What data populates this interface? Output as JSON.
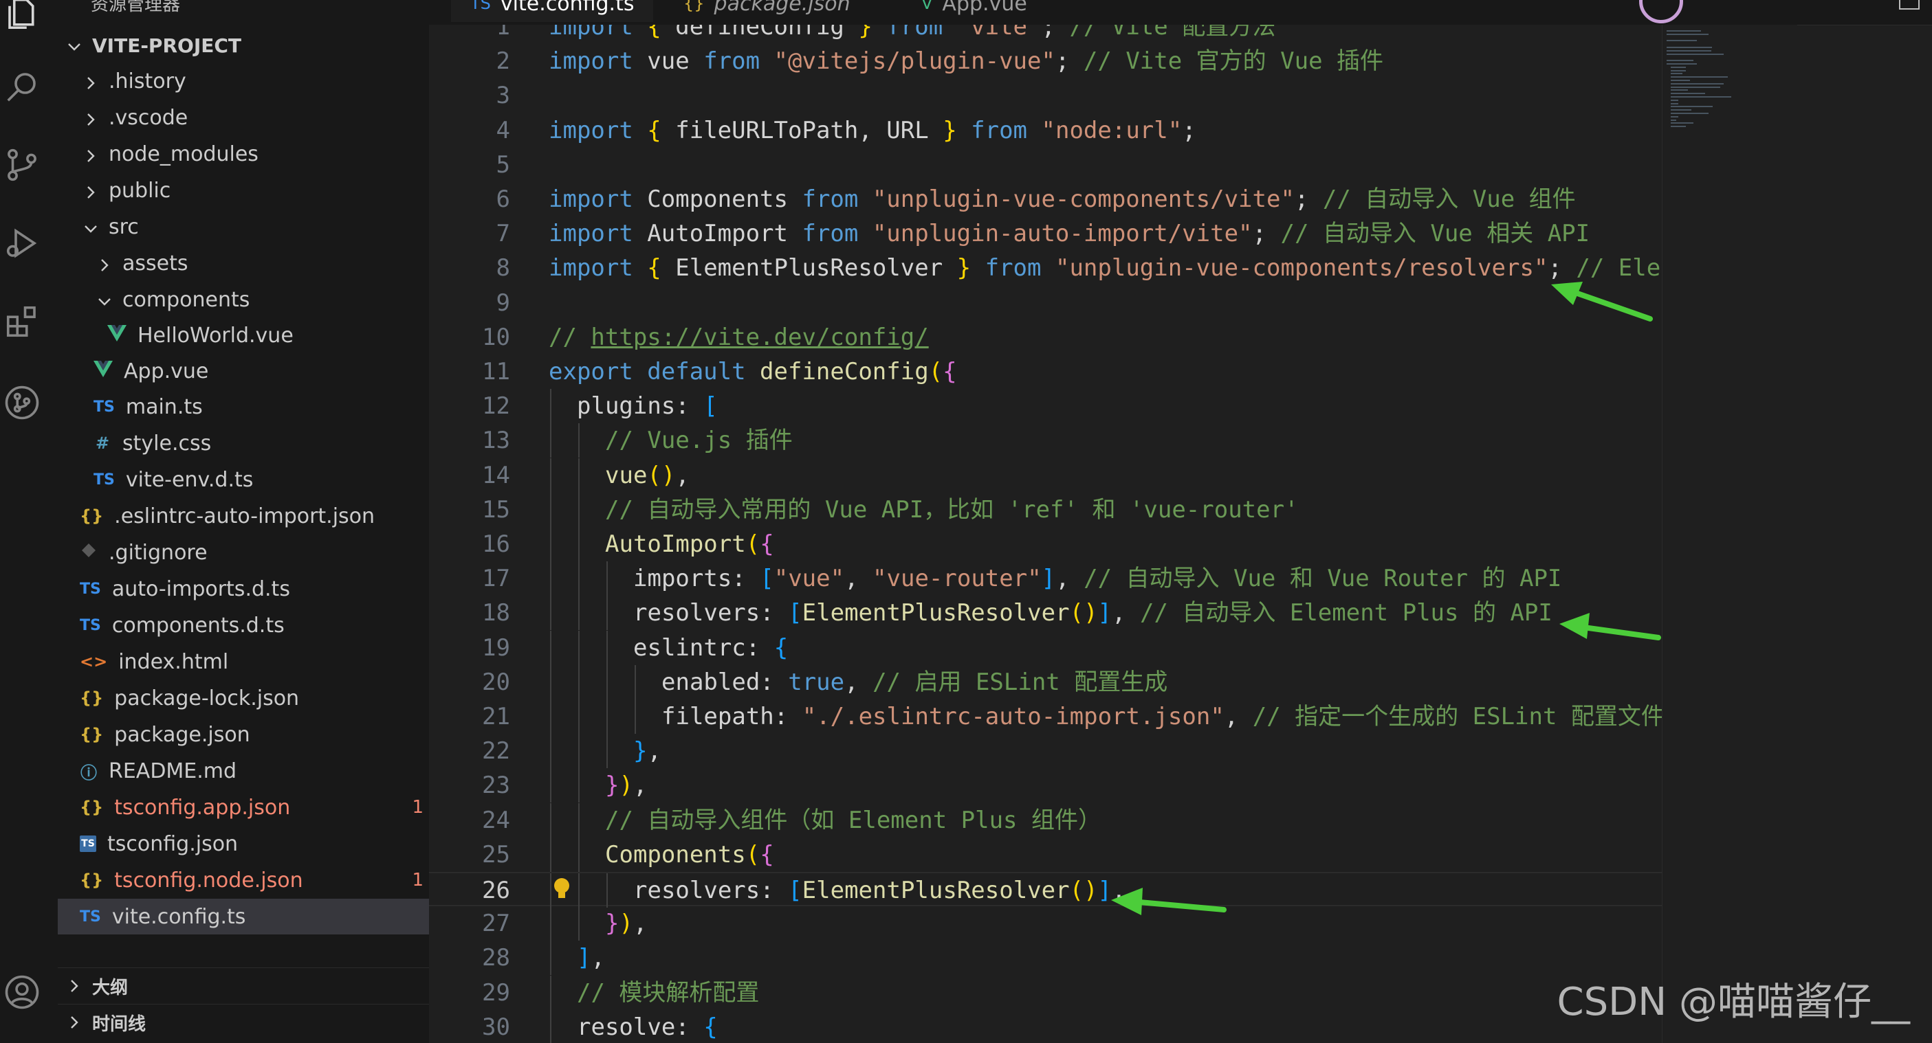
{
  "sidebar_title": "资源管理器",
  "project": {
    "name": "VITE-PROJECT"
  },
  "tree": [
    {
      "label": ".history",
      "kind": "folder",
      "expanded": false
    },
    {
      "label": ".vscode",
      "kind": "folder",
      "expanded": false
    },
    {
      "label": "node_modules",
      "kind": "folder",
      "expanded": false
    },
    {
      "label": "public",
      "kind": "folder",
      "expanded": false
    },
    {
      "label": "src",
      "kind": "folder",
      "expanded": true
    },
    {
      "label": "assets",
      "kind": "folder",
      "expanded": false
    },
    {
      "label": "components",
      "kind": "folder",
      "expanded": true
    },
    {
      "label": "HelloWorld.vue",
      "kind": "vue"
    },
    {
      "label": "App.vue",
      "kind": "vue"
    },
    {
      "label": "main.ts",
      "kind": "ts",
      "icon_text": "TS"
    },
    {
      "label": "style.css",
      "kind": "css",
      "icon_text": "#"
    },
    {
      "label": "vite-env.d.ts",
      "kind": "ts",
      "icon_text": "TS"
    },
    {
      "label": ".eslintrc-auto-import.json",
      "kind": "json",
      "icon_text": "{}"
    },
    {
      "label": ".gitignore",
      "kind": "git"
    },
    {
      "label": "auto-imports.d.ts",
      "kind": "ts",
      "icon_text": "TS"
    },
    {
      "label": "components.d.ts",
      "kind": "ts",
      "icon_text": "TS"
    },
    {
      "label": "index.html",
      "kind": "html",
      "icon_text": "<>"
    },
    {
      "label": "package-lock.json",
      "kind": "json",
      "icon_text": "{}"
    },
    {
      "label": "package.json",
      "kind": "json",
      "icon_text": "{}"
    },
    {
      "label": "README.md",
      "kind": "info",
      "icon_text": "ⓘ"
    },
    {
      "label": "tsconfig.app.json",
      "kind": "json",
      "icon_text": "{}",
      "badge": "1"
    },
    {
      "label": "tsconfig.json",
      "kind": "tsconfig",
      "icon_text": "TS"
    },
    {
      "label": "tsconfig.node.json",
      "kind": "json",
      "icon_text": "{}",
      "badge": "1"
    },
    {
      "label": "vite.config.ts",
      "kind": "ts",
      "icon_text": "TS"
    }
  ],
  "sections": {
    "outline": "大纲",
    "timeline": "时间线"
  },
  "tabs": [
    {
      "label": "vite.config.ts",
      "icon_text": "TS",
      "active": true
    },
    {
      "label": "package.json",
      "icon_text": "{}"
    },
    {
      "label": "App.vue",
      "icon_text": "V"
    }
  ],
  "code_lines": [
    {
      "n": "1",
      "indent": 0,
      "tokens": [
        [
          "k",
          "import "
        ],
        [
          "b1",
          "{ "
        ],
        [
          "id",
          "defineConfig "
        ],
        [
          "b1",
          "} "
        ],
        [
          "k",
          "from "
        ],
        [
          "str",
          "\"vite\""
        ],
        [
          "id",
          "; "
        ],
        [
          "com",
          "// Vite 配置方法"
        ]
      ]
    },
    {
      "n": "2",
      "indent": 0,
      "tokens": [
        [
          "k",
          "import "
        ],
        [
          "id",
          "vue "
        ],
        [
          "k",
          "from "
        ],
        [
          "str",
          "\"@vitejs/plugin-vue\""
        ],
        [
          "id",
          "; "
        ],
        [
          "com",
          "// Vite 官方的 Vue 插件"
        ]
      ]
    },
    {
      "n": "3",
      "indent": 0,
      "tokens": []
    },
    {
      "n": "4",
      "indent": 0,
      "tokens": [
        [
          "k",
          "import "
        ],
        [
          "b1",
          "{ "
        ],
        [
          "id",
          "fileURLToPath, URL "
        ],
        [
          "b1",
          "} "
        ],
        [
          "k",
          "from "
        ],
        [
          "str",
          "\"node:url\""
        ],
        [
          "id",
          ";"
        ]
      ]
    },
    {
      "n": "5",
      "indent": 0,
      "tokens": []
    },
    {
      "n": "6",
      "indent": 0,
      "tokens": [
        [
          "k",
          "import "
        ],
        [
          "id",
          "Components "
        ],
        [
          "k",
          "from "
        ],
        [
          "str",
          "\"unplugin-vue-components/vite\""
        ],
        [
          "id",
          "; "
        ],
        [
          "com",
          "// 自动导入 Vue 组件"
        ]
      ]
    },
    {
      "n": "7",
      "indent": 0,
      "tokens": [
        [
          "k",
          "import "
        ],
        [
          "id",
          "AutoImport "
        ],
        [
          "k",
          "from "
        ],
        [
          "str",
          "\"unplugin-auto-import/vite\""
        ],
        [
          "id",
          "; "
        ],
        [
          "com",
          "// 自动导入 Vue 相关 API"
        ]
      ]
    },
    {
      "n": "8",
      "indent": 0,
      "tokens": [
        [
          "k",
          "import "
        ],
        [
          "b1",
          "{ "
        ],
        [
          "id",
          "ElementPlusResolver "
        ],
        [
          "b1",
          "} "
        ],
        [
          "k",
          "from "
        ],
        [
          "str",
          "\"unplugin-vue-components/resolvers\""
        ],
        [
          "id",
          "; "
        ],
        [
          "com",
          "// Element Plus 组"
        ]
      ]
    },
    {
      "n": "9",
      "indent": 0,
      "tokens": []
    },
    {
      "n": "10",
      "indent": 0,
      "tokens": [
        [
          "com",
          "// "
        ],
        [
          "link",
          "https://vite.dev/config/"
        ]
      ]
    },
    {
      "n": "11",
      "indent": 0,
      "tokens": [
        [
          "k",
          "export default "
        ],
        [
          "fn",
          "defineConfig"
        ],
        [
          "b1",
          "("
        ],
        [
          "b2",
          "{"
        ]
      ]
    },
    {
      "n": "12",
      "indent": 1,
      "tokens": [
        [
          "id",
          "plugins: "
        ],
        [
          "b3",
          "["
        ]
      ]
    },
    {
      "n": "13",
      "indent": 2,
      "tokens": [
        [
          "com",
          "// Vue.js 插件"
        ]
      ]
    },
    {
      "n": "14",
      "indent": 2,
      "tokens": [
        [
          "fn",
          "vue"
        ],
        [
          "b1",
          "()"
        ],
        [
          "id",
          ","
        ]
      ]
    },
    {
      "n": "15",
      "indent": 2,
      "tokens": [
        [
          "com",
          "// 自动导入常用的 Vue API，比如 'ref' 和 'vue-router'"
        ]
      ]
    },
    {
      "n": "16",
      "indent": 2,
      "tokens": [
        [
          "fn",
          "AutoImport"
        ],
        [
          "b1",
          "("
        ],
        [
          "b2",
          "{"
        ]
      ]
    },
    {
      "n": "17",
      "indent": 3,
      "tokens": [
        [
          "id",
          "imports: "
        ],
        [
          "b3",
          "["
        ],
        [
          "str",
          "\"vue\""
        ],
        [
          "id",
          ", "
        ],
        [
          "str",
          "\"vue-router\""
        ],
        [
          "b3",
          "]"
        ],
        [
          "id",
          ", "
        ],
        [
          "com",
          "// 自动导入 Vue 和 Vue Router 的 API"
        ]
      ]
    },
    {
      "n": "18",
      "indent": 3,
      "tokens": [
        [
          "id",
          "resolvers: "
        ],
        [
          "b3",
          "["
        ],
        [
          "fn",
          "ElementPlusResolver"
        ],
        [
          "b1",
          "()"
        ],
        [
          "b3",
          "]"
        ],
        [
          "id",
          ", "
        ],
        [
          "com",
          "// 自动导入 Element Plus 的 API"
        ]
      ]
    },
    {
      "n": "19",
      "indent": 3,
      "tokens": [
        [
          "id",
          "eslintrc: "
        ],
        [
          "b3",
          "{"
        ]
      ]
    },
    {
      "n": "20",
      "indent": 4,
      "tokens": [
        [
          "id",
          "enabled: "
        ],
        [
          "k",
          "true"
        ],
        [
          "id",
          ", "
        ],
        [
          "com",
          "// 启用 ESLint 配置生成"
        ]
      ]
    },
    {
      "n": "21",
      "indent": 4,
      "tokens": [
        [
          "id",
          "filepath: "
        ],
        [
          "str",
          "\"./.eslintrc-auto-import.json\""
        ],
        [
          "id",
          ", "
        ],
        [
          "com",
          "// 指定一个生成的 ESLint 配置文件路径"
        ]
      ]
    },
    {
      "n": "22",
      "indent": 3,
      "tokens": [
        [
          "b3",
          "}"
        ],
        [
          "id",
          ","
        ]
      ]
    },
    {
      "n": "23",
      "indent": 2,
      "tokens": [
        [
          "b2",
          "}"
        ],
        [
          "b1",
          ")"
        ],
        [
          "id",
          ","
        ]
      ]
    },
    {
      "n": "24",
      "indent": 2,
      "tokens": [
        [
          "com",
          "// 自动导入组件（如 Element Plus 组件）"
        ]
      ]
    },
    {
      "n": "25",
      "indent": 2,
      "tokens": [
        [
          "fn",
          "Components"
        ],
        [
          "b1",
          "("
        ],
        [
          "b2",
          "{"
        ]
      ]
    },
    {
      "n": "26",
      "indent": 3,
      "current": true,
      "tokens": [
        [
          "id",
          "resolvers: "
        ],
        [
          "b3",
          "["
        ],
        [
          "fn",
          "ElementPlusResolver"
        ],
        [
          "b1",
          "()"
        ],
        [
          "b3",
          "]"
        ],
        [
          "id",
          ","
        ]
      ]
    },
    {
      "n": "27",
      "indent": 2,
      "tokens": [
        [
          "b2",
          "}"
        ],
        [
          "b1",
          ")"
        ],
        [
          "id",
          ","
        ]
      ]
    },
    {
      "n": "28",
      "indent": 1,
      "tokens": [
        [
          "b3",
          "]"
        ],
        [
          "id",
          ","
        ]
      ]
    },
    {
      "n": "29",
      "indent": 1,
      "tokens": [
        [
          "com",
          "// 模块解析配置"
        ]
      ]
    },
    {
      "n": "30",
      "indent": 1,
      "tokens": [
        [
          "id",
          "resolve: "
        ],
        [
          "b3",
          "{"
        ]
      ]
    }
  ],
  "watermark": "CSDN @喵喵酱仔__",
  "colors": {
    "accent_arrow": "#4ccd3a",
    "error": "#f48771",
    "selected_row": "#37373d"
  }
}
